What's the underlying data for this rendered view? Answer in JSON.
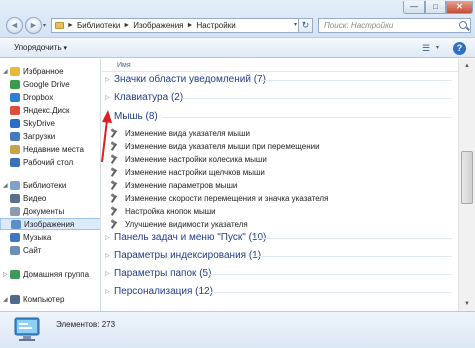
{
  "window": {
    "controls": {
      "minimize": "—",
      "maximize": "□",
      "close": "✕"
    },
    "nav": {
      "back": "◄",
      "forward": "►",
      "dropdown": "▾",
      "refresh": "↻"
    },
    "breadcrumb": [
      "Библиотеки",
      "Изображения",
      "Настройки"
    ],
    "breadcrumb_separator": "►",
    "search_placeholder": "Поиск: Настройки"
  },
  "toolbar": {
    "organize_label": "Упорядочить",
    "view_icon": "view-icon",
    "help_icon": "help-icon",
    "help_glyph": "?",
    "layout_glyph": "▾"
  },
  "sidebar": {
    "favorites": {
      "label": "Избранное",
      "items": [
        {
          "label": "Google Drive",
          "color": "#3c9a4a"
        },
        {
          "label": "Dropbox",
          "color": "#2c7fd6"
        },
        {
          "label": "Яндекс.Диск",
          "color": "#e04b3c"
        },
        {
          "label": "SkyDrive",
          "color": "#2b6cc8"
        },
        {
          "label": "Загрузки",
          "color": "#4679c4"
        },
        {
          "label": "Недавние места",
          "color": "#c9a34a"
        },
        {
          "label": "Рабочий стол",
          "color": "#3a72b8"
        }
      ]
    },
    "libraries": {
      "label": "Библиотеки",
      "items": [
        {
          "label": "Видео",
          "color": "#5b6f8c"
        },
        {
          "label": "Документы",
          "color": "#8c9bb0"
        },
        {
          "label": "Изображения",
          "color": "#5b8fc9",
          "selected": true
        },
        {
          "label": "Музыка",
          "color": "#3f78c1"
        },
        {
          "label": "Сайт",
          "color": "#6e8db8"
        }
      ]
    },
    "homegroup": {
      "label": "Домашняя группа",
      "color": "#3f9a57"
    },
    "computer": {
      "label": "Компьютер",
      "color": "#4f6a8c"
    }
  },
  "content": {
    "column_header": "Имя",
    "groups_above": [
      {
        "title": "Значки области уведомлений (7)"
      },
      {
        "title": "Клавиатура (2)"
      }
    ],
    "expanded_group": {
      "title": "Мышь (8)",
      "items": [
        "Изменение вида указателя мыши",
        "Изменение вида указателя мыши при перемещении",
        "Изменение настройки колесика мыши",
        "Изменение настройки щелчков мыши",
        "Изменение параметров мыши",
        "Изменение скорости перемещения и значка указателя",
        "Настройка кнопок мыши",
        "Улучшение видимости указателя"
      ]
    },
    "groups_below": [
      {
        "title": "Панель задач и меню \"Пуск\" (10)"
      },
      {
        "title": "Параметры индексирования (1)"
      },
      {
        "title": "Параметры папок (5)"
      },
      {
        "title": "Персонализация (12)"
      }
    ],
    "expanded_caret": "◢",
    "collapsed_caret": "▷"
  },
  "scrollbar": {
    "up": "▲",
    "down": "▼"
  },
  "status": {
    "items_label": "Элементов: 273"
  },
  "colors": {
    "group_title": "#1f3f8a",
    "annotation_arrow": "#e02020"
  }
}
